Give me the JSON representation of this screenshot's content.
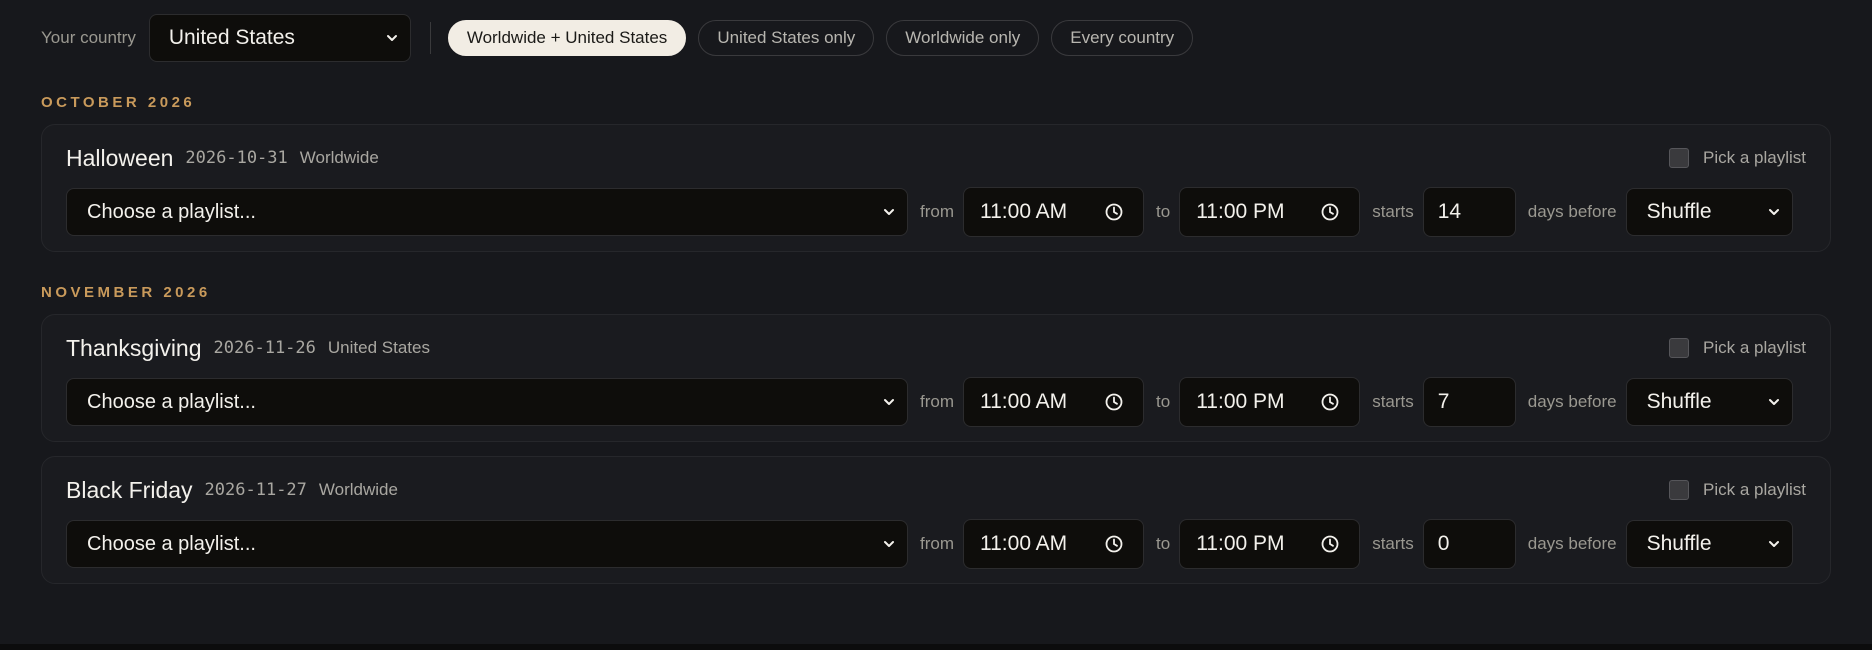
{
  "filter": {
    "country_label": "Your country",
    "country_value": "United States",
    "chips": [
      {
        "label": "Worldwide + United States",
        "active": true
      },
      {
        "label": "United States only",
        "active": false
      },
      {
        "label": "Worldwide only",
        "active": false
      },
      {
        "label": "Every country",
        "active": false
      }
    ]
  },
  "months": [
    {
      "label": "OCTOBER 2026",
      "events": [
        {
          "name": "Halloween",
          "date": "2026-10-31",
          "scope": "Worldwide",
          "pick_label": "Pick a playlist",
          "playlist_placeholder": "Choose a playlist...",
          "from_label": "from",
          "from_time": "11:00 AM",
          "to_label": "to",
          "to_time": "11:00 PM",
          "starts_label": "starts",
          "days": "14",
          "days_label": "days before",
          "mode": "Shuffle"
        }
      ]
    },
    {
      "label": "NOVEMBER 2026",
      "events": [
        {
          "name": "Thanksgiving",
          "date": "2026-11-26",
          "scope": "United States",
          "pick_label": "Pick a playlist",
          "playlist_placeholder": "Choose a playlist...",
          "from_label": "from",
          "from_time": "11:00 AM",
          "to_label": "to",
          "to_time": "11:00 PM",
          "starts_label": "starts",
          "days": "7",
          "days_label": "days before",
          "mode": "Shuffle"
        },
        {
          "name": "Black Friday",
          "date": "2026-11-27",
          "scope": "Worldwide",
          "pick_label": "Pick a playlist",
          "playlist_placeholder": "Choose a playlist...",
          "from_label": "from",
          "from_time": "11:00 AM",
          "to_label": "to",
          "to_time": "11:00 PM",
          "starts_label": "starts",
          "days": "0",
          "days_label": "days before",
          "mode": "Shuffle"
        }
      ]
    }
  ],
  "colors": {
    "background": "#17181c",
    "month_accent": "#c99a5b",
    "active_chip": "#f2ede4"
  }
}
